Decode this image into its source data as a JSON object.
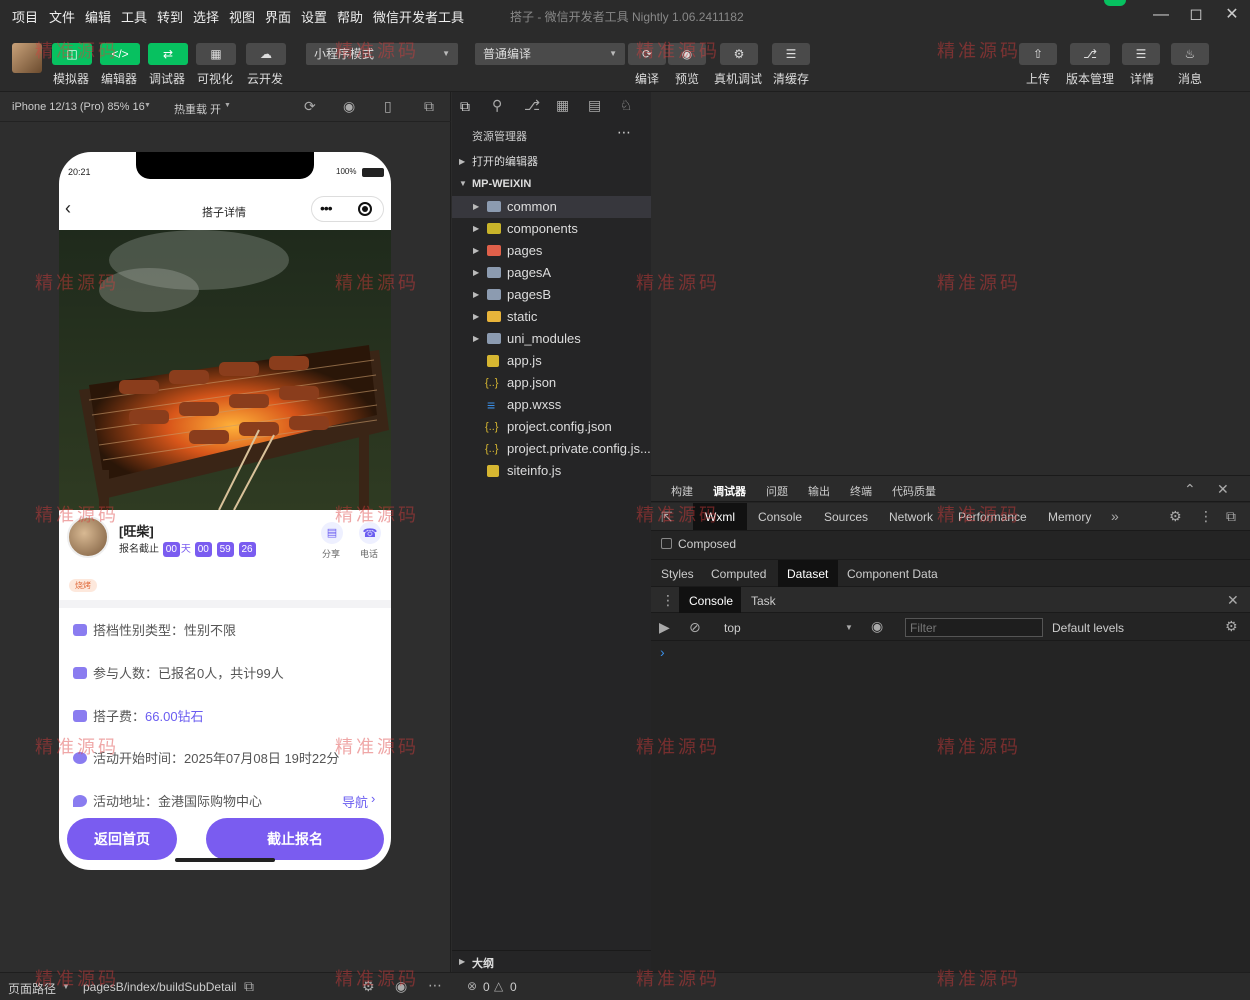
{
  "menu": {
    "items": [
      "项目",
      "文件",
      "编辑",
      "工具",
      "转到",
      "选择",
      "视图",
      "界面",
      "设置",
      "帮助",
      "微信开发者工具"
    ],
    "window_title": "搭子 - 微信开发者工具 Nightly 1.06.2411182"
  },
  "toolbar": {
    "simulator": "模拟器",
    "editor": "编辑器",
    "debugger": "调试器",
    "visual": "可视化",
    "cloud": "云开发",
    "mode_select": "小程序模式",
    "compile_select": "普通编译",
    "compile": "编译",
    "preview": "预览",
    "real_debug": "真机调试",
    "clear_cache": "清缓存",
    "upload": "上传",
    "version": "版本管理",
    "details": "详情",
    "messages": "消息"
  },
  "simulator": {
    "device": "iPhone 12/13 (Pro) 85% 16",
    "hot_reload": "热重载 开"
  },
  "phone": {
    "time": "20:21",
    "battery": "100%",
    "nav_title": "搭子详情",
    "host_name": "[旺柴]",
    "deadline_label": "报名截止",
    "countdown": [
      "00",
      "天",
      "00",
      "59",
      "26"
    ],
    "share": "分享",
    "phone_call": "电话",
    "category_tag": "烧烤",
    "gender_label": "搭档性别类型：性别不限",
    "participants_label": "参与人数：已报名0人，共计99人",
    "fee_prefix": "搭子费：",
    "fee_value": "66.00钻石",
    "start_time_label": "活动开始时间：2025年07月08日 19时22分",
    "address_label": "活动地址：金港国际购物中心",
    "navigate": "导航",
    "home_button": "返回首页",
    "closed_button": "截止报名"
  },
  "explorer": {
    "title": "资源管理器",
    "open_editors": "打开的编辑器",
    "project": "MP-WEIXIN",
    "folders": [
      "common",
      "components",
      "pages",
      "pagesA",
      "pagesB",
      "static",
      "uni_modules"
    ],
    "files": [
      "app.js",
      "app.json",
      "app.wxss",
      "project.config.json",
      "project.private.config.js...",
      "siteinfo.js"
    ],
    "outline": "大纲"
  },
  "devtools": {
    "top_tabs": [
      "构建",
      "调试器",
      "问题",
      "输出",
      "终端",
      "代码质量"
    ],
    "panel_tabs": [
      "Wxml",
      "Console",
      "Sources",
      "Network",
      "Performance",
      "Memory"
    ],
    "composed": "Composed",
    "style_tabs": [
      "Styles",
      "Computed",
      "Dataset",
      "Component Data"
    ],
    "drawer_tabs": [
      "Console",
      "Task"
    ],
    "context": "top",
    "filter_placeholder": "Filter",
    "levels": "Default levels",
    "prompt": "›"
  },
  "statusbar": {
    "path_label": "页面路径",
    "path": "pagesB/index/buildSubDetail",
    "errors": "0",
    "warnings": "0"
  },
  "watermark": "精准源码"
}
